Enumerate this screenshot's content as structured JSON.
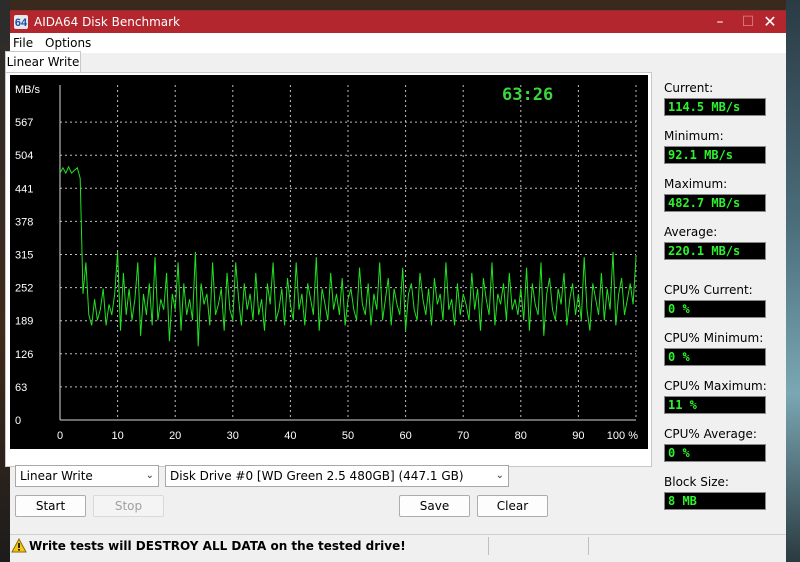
{
  "window": {
    "title": "AIDA64 Disk Benchmark"
  },
  "menu": {
    "file": "File",
    "options": "Options"
  },
  "tab": {
    "label": "Linear Write"
  },
  "chart_data": {
    "type": "line",
    "title": "",
    "xlabel": "",
    "ylabel": "MB/s",
    "xlim": [
      0,
      100
    ],
    "ylim": [
      0,
      630
    ],
    "x_ticks": [
      "0",
      "10",
      "20",
      "30",
      "40",
      "50",
      "60",
      "70",
      "80",
      "90",
      "100 %"
    ],
    "y_ticks": [
      "0",
      "63",
      "126",
      "189",
      "252",
      "315",
      "378",
      "441",
      "504",
      "567"
    ],
    "grid": true,
    "timer": "63:26",
    "series": [
      {
        "color": "#22e022",
        "x": [
          0,
          0.5,
          1,
          1.5,
          2,
          2.5,
          3,
          3.5,
          4,
          4.5,
          5,
          5.5,
          6,
          6.5,
          7,
          7.5,
          8,
          8.5,
          9,
          9.5,
          10,
          10.5,
          11,
          11.5,
          12,
          12.5,
          13,
          13.5,
          14,
          14.5,
          15,
          15.5,
          16,
          16.5,
          17,
          17.5,
          18,
          18.5,
          19,
          19.5,
          20,
          20.5,
          21,
          21.5,
          22,
          22.5,
          23,
          23.5,
          24,
          24.5,
          25,
          25.5,
          26,
          26.5,
          27,
          27.5,
          28,
          28.5,
          29,
          29.5,
          30,
          30.5,
          31,
          31.5,
          32,
          32.5,
          33,
          33.5,
          34,
          34.5,
          35,
          35.5,
          36,
          36.5,
          37,
          37.5,
          38,
          38.5,
          39,
          39.5,
          40,
          40.5,
          41,
          41.5,
          42,
          42.5,
          43,
          43.5,
          44,
          44.5,
          45,
          45.5,
          46,
          46.5,
          47,
          47.5,
          48,
          48.5,
          49,
          49.5,
          50,
          50.5,
          51,
          51.5,
          52,
          52.5,
          53,
          53.5,
          54,
          54.5,
          55,
          55.5,
          56,
          56.5,
          57,
          57.5,
          58,
          58.5,
          59,
          59.5,
          60,
          60.5,
          61,
          61.5,
          62,
          62.5,
          63,
          63.5,
          64,
          64.5,
          65,
          65.5,
          66,
          66.5,
          67,
          67.5,
          68,
          68.5,
          69,
          69.5,
          70,
          70.5,
          71,
          71.5,
          72,
          72.5,
          73,
          73.5,
          74,
          74.5,
          75,
          75.5,
          76,
          76.5,
          77,
          77.5,
          78,
          78.5,
          79,
          79.5,
          80,
          80.5,
          81,
          81.5,
          82,
          82.5,
          83,
          83.5,
          84,
          84.5,
          85,
          85.5,
          86,
          86.5,
          87,
          87.5,
          88,
          88.5,
          89,
          89.5,
          90,
          90.5,
          91,
          91.5,
          92,
          92.5,
          93,
          93.5,
          94,
          94.5,
          95,
          95.5,
          96,
          96.5,
          97,
          97.5,
          98,
          98.5,
          99,
          99.5,
          100
        ],
        "y": [
          470,
          480,
          470,
          482,
          470,
          475,
          480,
          460,
          240,
          300,
          200,
          180,
          230,
          190,
          210,
          250,
          180,
          220,
          200,
          240,
          320,
          170,
          280,
          200,
          250,
          190,
          230,
          300,
          160,
          240,
          200,
          260,
          180,
          310,
          190,
          230,
          210,
          280,
          150,
          240,
          210,
          300,
          170,
          260,
          200,
          230,
          190,
          320,
          140,
          260,
          220,
          240,
          180,
          300,
          200,
          220,
          250,
          170,
          280,
          210,
          190,
          300,
          230,
          180,
          260,
          210,
          240,
          190,
          280,
          200,
          230,
          170,
          260,
          220,
          300,
          190,
          210,
          250,
          180,
          270,
          220,
          190,
          300,
          210,
          240,
          180,
          260,
          230,
          200,
          310,
          170,
          250,
          220,
          190,
          280,
          210,
          240,
          200,
          270,
          180,
          230,
          250,
          210,
          190,
          290,
          220,
          200,
          260,
          180,
          240,
          210,
          300,
          190,
          230,
          270,
          180,
          250,
          220,
          200,
          290,
          170,
          240,
          260,
          210,
          190,
          280,
          230,
          200,
          250,
          180,
          270,
          220,
          240,
          190,
          300,
          210,
          230,
          180,
          260,
          200,
          240,
          220,
          190,
          280,
          210,
          250,
          170,
          270,
          230,
          200,
          300,
          180,
          240,
          220,
          260,
          190,
          280,
          210,
          230,
          200,
          250,
          190,
          290,
          170,
          260,
          220,
          200,
          300,
          160,
          240,
          270,
          210,
          190,
          250,
          220,
          280,
          180,
          230,
          260,
          200,
          240,
          190,
          310,
          210,
          170,
          260,
          230,
          200,
          280,
          190,
          250,
          210,
          320,
          180,
          240,
          270,
          200,
          230,
          260,
          220,
          310
        ]
      }
    ]
  },
  "stats": {
    "current_label": "Current:",
    "current_value": "114.5 MB/s",
    "minimum_label": "Minimum:",
    "minimum_value": "92.1 MB/s",
    "maximum_label": "Maximum:",
    "maximum_value": "482.7 MB/s",
    "average_label": "Average:",
    "average_value": "220.1 MB/s",
    "cpu_current_label": "CPU% Current:",
    "cpu_current_value": "0 %",
    "cpu_minimum_label": "CPU% Minimum:",
    "cpu_minimum_value": "0 %",
    "cpu_maximum_label": "CPU% Maximum:",
    "cpu_maximum_value": "11 %",
    "cpu_average_label": "CPU% Average:",
    "cpu_average_value": "0 %",
    "block_size_label": "Block Size:",
    "block_size_value": "8 MB"
  },
  "controls": {
    "test_select": "Linear Write",
    "drive_select": "Disk Drive #0  [WD Green 2.5 480GB]  (447.1 GB)",
    "start": "Start",
    "stop": "Stop",
    "save": "Save",
    "clear": "Clear"
  },
  "status": {
    "warning": "Write tests will DESTROY ALL DATA on the tested drive!"
  },
  "colors": {
    "titlebar": "#b3262e",
    "graph_line": "#22e022",
    "readout_text": "#2ef22e",
    "timer": "#3bd63b"
  }
}
